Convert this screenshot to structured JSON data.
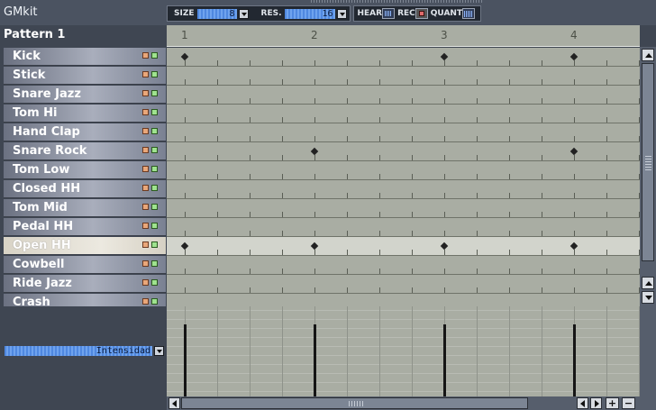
{
  "app": {
    "kit_name": "GMkit",
    "pattern_name": "Pattern 1"
  },
  "toolbar": {
    "size_label": "SIZE",
    "size_value": "8",
    "res_label": "RES.",
    "res_value": "16",
    "hear_label": "HEAR",
    "rec_label": "REC",
    "quant_label": "QUANT"
  },
  "ruler": {
    "beats": [
      "1",
      "2",
      "3",
      "4"
    ]
  },
  "instruments": [
    {
      "name": "Kick",
      "notes": [
        0,
        8,
        12
      ]
    },
    {
      "name": "Stick",
      "notes": []
    },
    {
      "name": "Snare Jazz",
      "notes": []
    },
    {
      "name": "Tom Hi",
      "notes": []
    },
    {
      "name": "Hand Clap",
      "notes": []
    },
    {
      "name": "Snare Rock",
      "notes": [
        4,
        12
      ]
    },
    {
      "name": "Tom Low",
      "notes": []
    },
    {
      "name": "Closed HH",
      "notes": []
    },
    {
      "name": "Tom Mid",
      "notes": []
    },
    {
      "name": "Pedal HH",
      "notes": []
    },
    {
      "name": "Open HH",
      "notes": [
        0,
        4,
        8,
        12
      ],
      "selected": true
    },
    {
      "name": "Cowbell",
      "notes": []
    },
    {
      "name": "Ride Jazz",
      "notes": []
    },
    {
      "name": "Crash",
      "notes": []
    }
  ],
  "note_properties": {
    "selected_property": "Intensidad",
    "velocity_notes": [
      0,
      4,
      8,
      12
    ],
    "velocity_levels": [
      0.8,
      0.8,
      0.8,
      0.8
    ]
  }
}
